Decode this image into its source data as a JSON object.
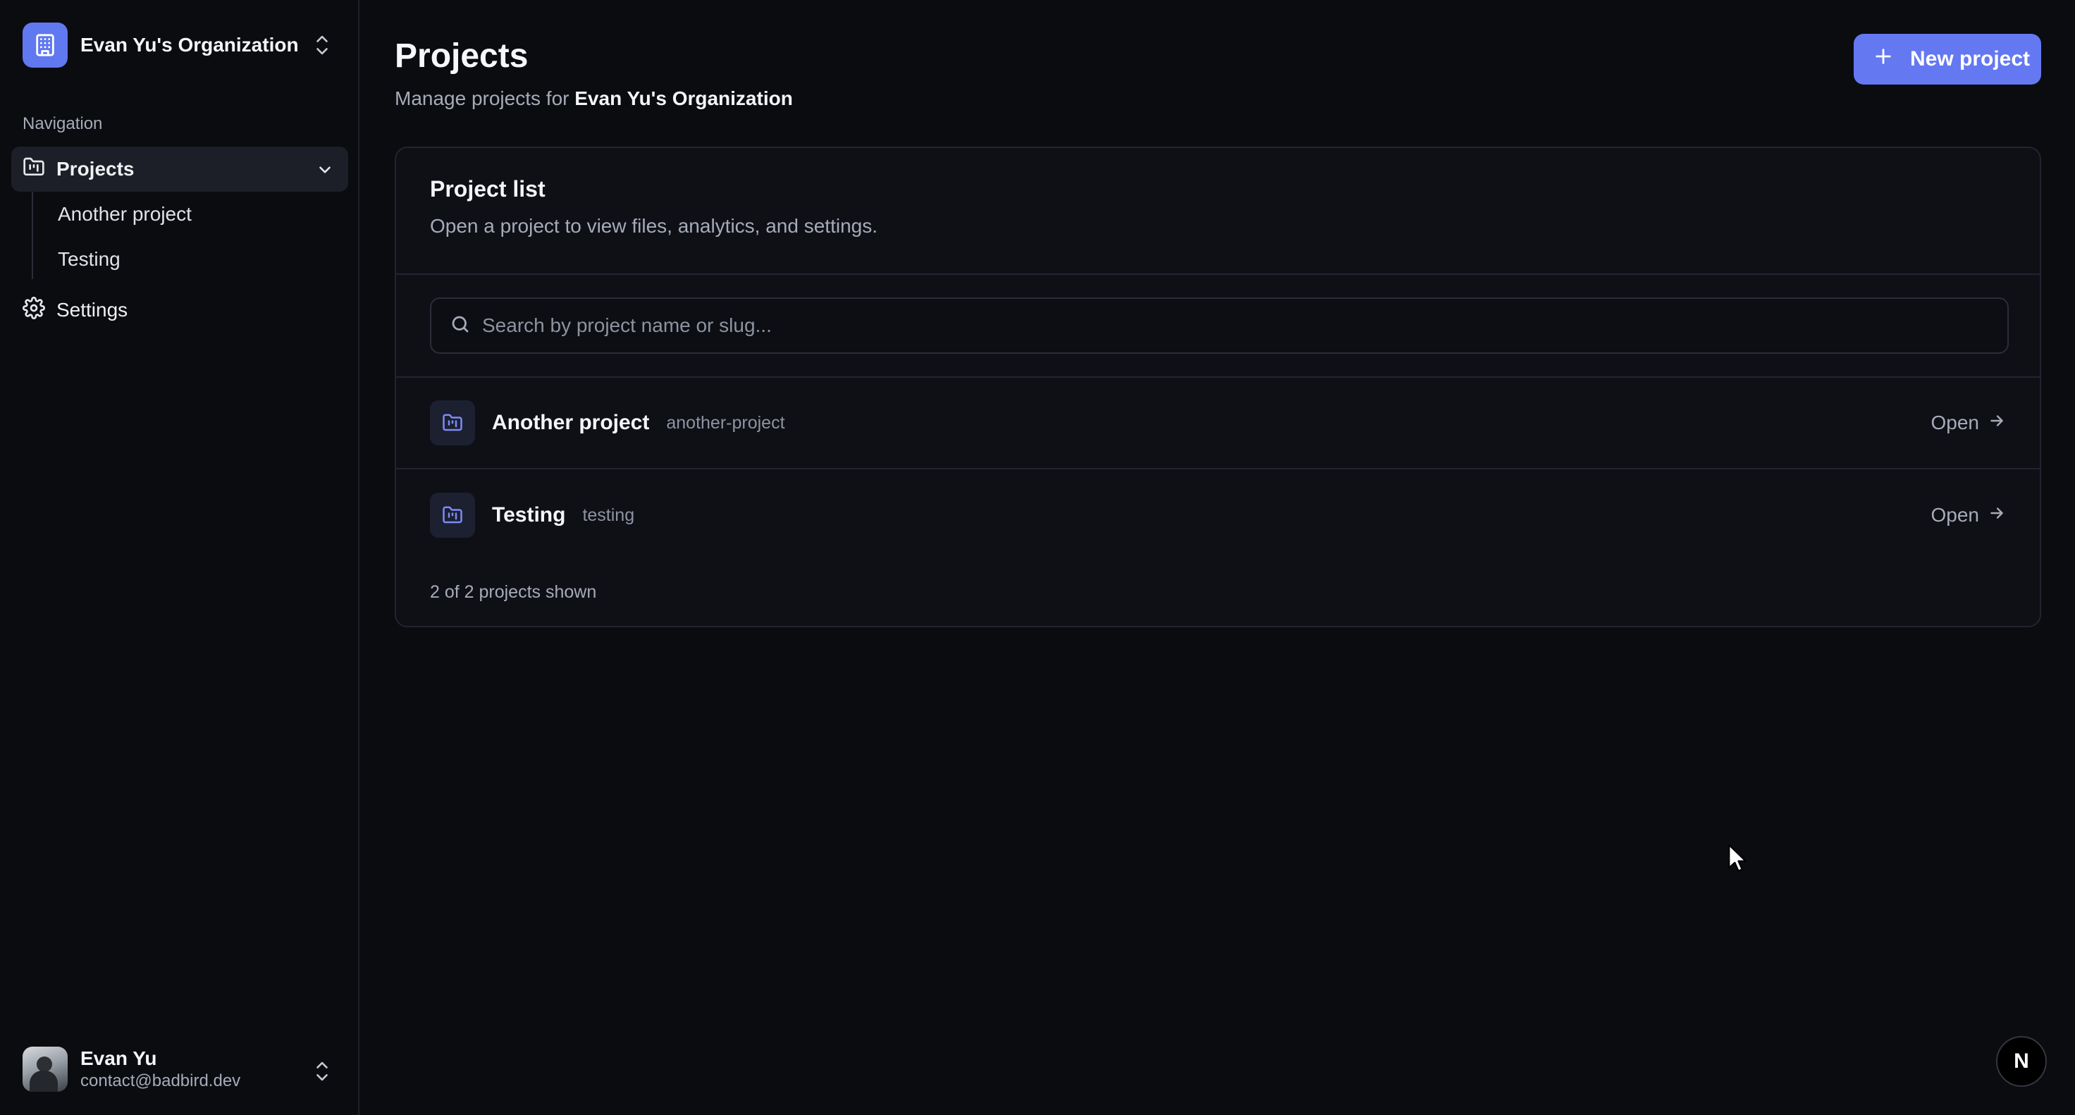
{
  "sidebar": {
    "org_name": "Evan Yu's Organization",
    "nav_label": "Navigation",
    "items": [
      {
        "label": "Projects",
        "icon": "folder-kanban-icon"
      },
      {
        "label": "Settings",
        "icon": "gear-icon"
      }
    ],
    "sub_items": [
      {
        "label": "Another project"
      },
      {
        "label": "Testing"
      }
    ],
    "user": {
      "name": "Evan Yu",
      "email": "contact@badbird.dev"
    }
  },
  "header": {
    "title": "Projects",
    "subtitle_prefix": "Manage projects for",
    "subtitle_org": "Evan Yu's Organization",
    "new_button": "New project"
  },
  "card": {
    "title": "Project list",
    "description": "Open a project to view files, analytics, and settings.",
    "search_placeholder": "Search by project name or slug...",
    "projects": [
      {
        "name": "Another project",
        "slug": "another-project",
        "action": "Open"
      },
      {
        "name": "Testing",
        "slug": "testing",
        "action": "Open"
      }
    ],
    "count_text": "2 of 2 projects shown"
  },
  "badge": {
    "letter": "N"
  },
  "colors": {
    "accent": "#6478f2",
    "background": "#0b0c10",
    "card": "#0e1016"
  }
}
